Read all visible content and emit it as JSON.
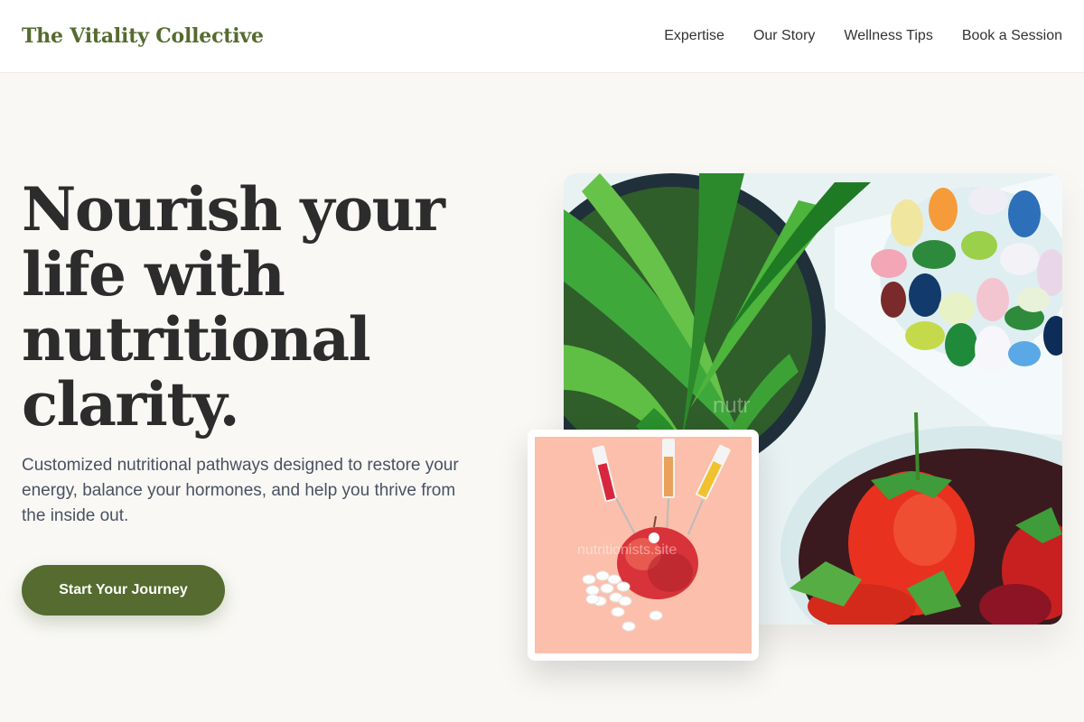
{
  "brand": {
    "name": "The Vitality Collective",
    "color": "#556b2f"
  },
  "nav": {
    "items": [
      "Expertise",
      "Our Story",
      "Wellness Tips",
      "Book a Session"
    ]
  },
  "hero": {
    "headline": "Nourish your life with nutritional clarity.",
    "subtext": "Customized nutritional pathways designed to restore your energy, balance your hormones, and help you thrive from the inside out.",
    "cta_label": "Start Your Journey"
  },
  "images": {
    "main": "plant-strawberries-jellybeans-photo",
    "secondary": "apple-syringes-pills-photo"
  },
  "watermarks": {
    "main": "nutr",
    "secondary": "nutritionists.site"
  }
}
